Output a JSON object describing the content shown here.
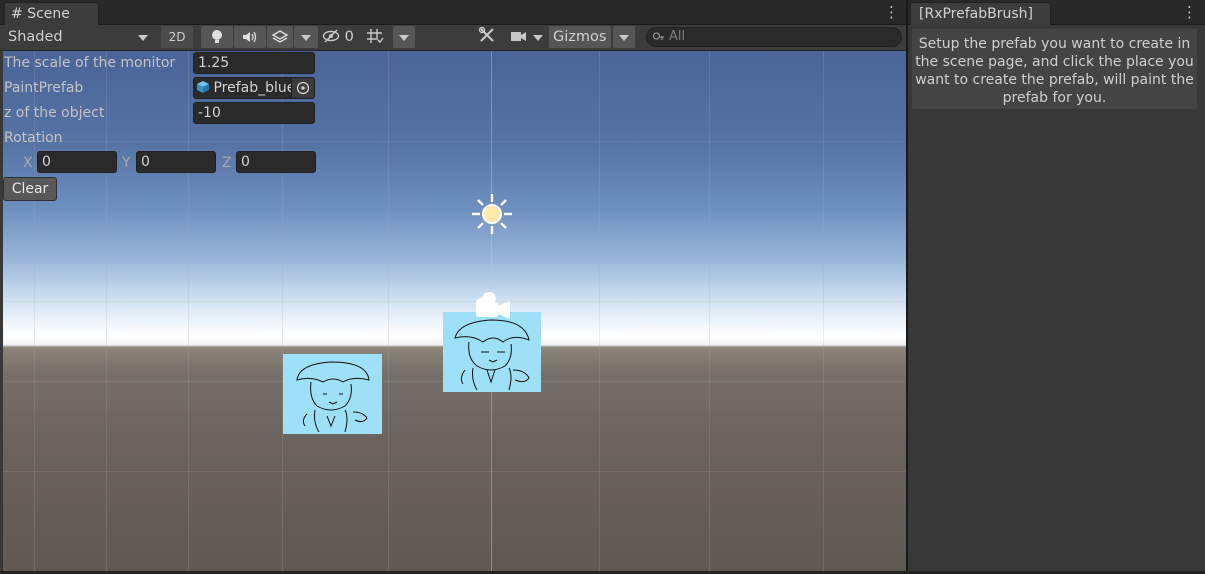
{
  "scene": {
    "tab_label": "Scene",
    "tab_icon": "hash-grid-icon",
    "toolbar": {
      "draw_mode": "Shaded",
      "mode_2d": "2D",
      "hidden_count": "0",
      "gizmos": "Gizmos",
      "search_placeholder": "All"
    },
    "overlay": {
      "scale_label": "The scale of the monitor",
      "scale_value": "1.25",
      "prefab_label": "PaintPrefab",
      "prefab_value": "Prefab_blue",
      "z_label": "z of the object",
      "z_value": "-10",
      "rotation_label": "Rotation",
      "rot_x_label": "X",
      "rot_x_value": "0",
      "rot_y_label": "Y",
      "rot_y_value": "0",
      "rot_z_label": "Z",
      "rot_z_value": "0",
      "clear_button": "Clear"
    }
  },
  "brush": {
    "tab_label": "[RxPrefabBrush]",
    "help_text": "Setup the prefab you want to create in the scene page, and click the place you want to create the prefab, will paint the prefab for you."
  },
  "colors": {
    "sprite_fill": "#9ee0f8",
    "panel_bg": "#383838",
    "field_bg": "#2a2a2a"
  }
}
